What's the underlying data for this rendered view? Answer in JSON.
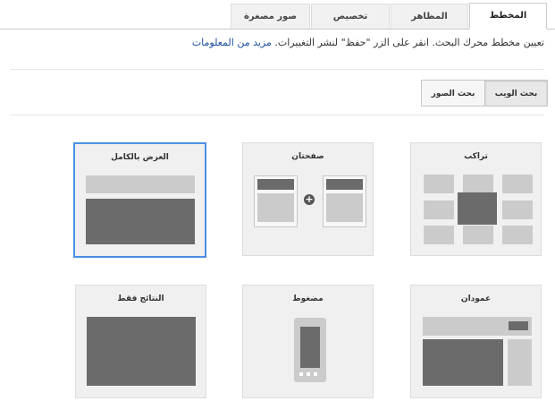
{
  "tabs": [
    {
      "label": "المخطط",
      "active": true
    },
    {
      "label": "المظاهر",
      "active": false
    },
    {
      "label": "تخصيص",
      "active": false
    },
    {
      "label": "صور مصغرة",
      "active": false
    }
  ],
  "description": {
    "text": "تعيين مخطط محرك البحث. انقر على الزر \"حفظ\" لنشر التغييرات.",
    "link": "مزيد من المعلومات"
  },
  "search_type": {
    "web_label": "بحث الويب",
    "images_label": "بحث الصور",
    "selected": "web"
  },
  "layouts": [
    {
      "label": "تراكب",
      "selected": false
    },
    {
      "label": "صفحتان",
      "selected": false
    },
    {
      "label": "العرض بالكامل",
      "selected": true
    },
    {
      "label": "عمودان",
      "selected": false
    },
    {
      "label": "مضغوط",
      "selected": false
    },
    {
      "label": "النتائج فقط",
      "selected": false
    }
  ],
  "colors": {
    "accent": "#4a90e2",
    "link": "#1a4ea0",
    "dark_block": "#6b6b6b",
    "light_block": "#cbcbcb"
  }
}
